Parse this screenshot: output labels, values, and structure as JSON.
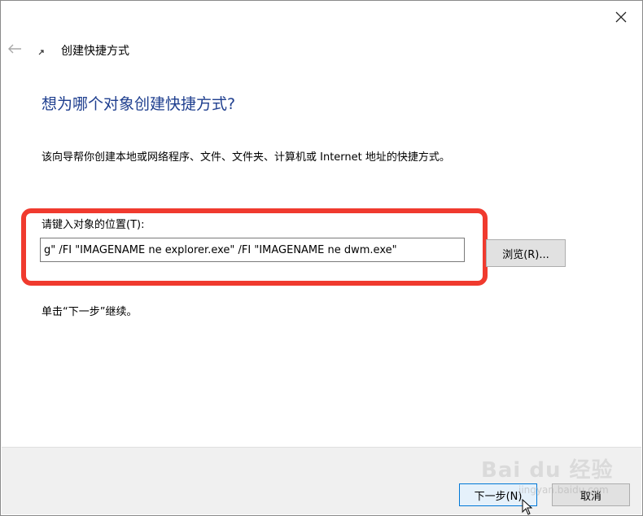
{
  "wizard": {
    "title": "创建快捷方式",
    "heading": "想为哪个对象创建快捷方式?",
    "description": "该向导帮你创建本地或网络程序、文件、文件夹、计算机或 Internet 地址的快捷方式。",
    "location_label": "请键入对象的位置(T):",
    "location_value": "g\" /FI \"IMAGENAME ne explorer.exe\" /FI \"IMAGENAME ne dwm.exe\"",
    "browse_label": "浏览(R)...",
    "hint": "单击“下一步”继续。"
  },
  "footer": {
    "next_label": "下一步(N)",
    "cancel_label": "取消"
  },
  "watermark": {
    "brand": "Bai du 经验",
    "url": "jingyan.baidu.com"
  },
  "colors": {
    "heading": "#1f3f8f",
    "highlight": "#f03a2e",
    "default_button_border": "#0078d7"
  },
  "icons": {
    "close": "close-icon",
    "back": "back-arrow-icon",
    "wizard": "shortcut-icon",
    "cursor": "mouse-pointer-icon"
  }
}
